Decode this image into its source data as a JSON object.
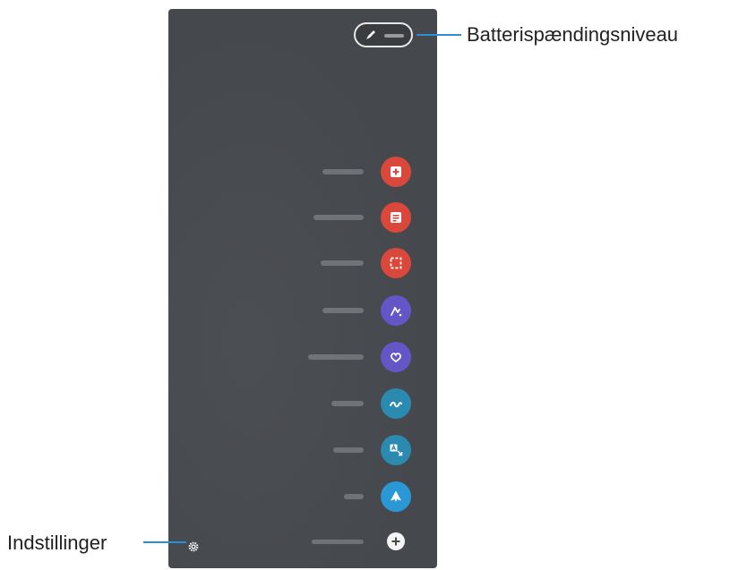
{
  "callouts": {
    "battery": "Batterispændingsniveau",
    "settings": "Indstillinger"
  },
  "colors": {
    "callout_line": "#2b8fd6",
    "panel_bg": "#45484d"
  },
  "menu": {
    "items": [
      {
        "icon": "create-note-icon",
        "color": "#d9483b"
      },
      {
        "icon": "view-all-notes-icon",
        "color": "#d9483b"
      },
      {
        "icon": "smart-select-icon",
        "color": "#d9483b"
      },
      {
        "icon": "screen-write-icon",
        "color": "#6456c6"
      },
      {
        "icon": "live-message-icon",
        "color": "#6456c6"
      },
      {
        "icon": "ar-doodle-icon",
        "color": "#2b8ab0"
      },
      {
        "icon": "translate-icon",
        "color": "#2b8ab0"
      },
      {
        "icon": "pen-up-icon",
        "color": "#2b98d6"
      }
    ],
    "add_icon": "plus-icon",
    "settings_icon": "gear-icon"
  }
}
